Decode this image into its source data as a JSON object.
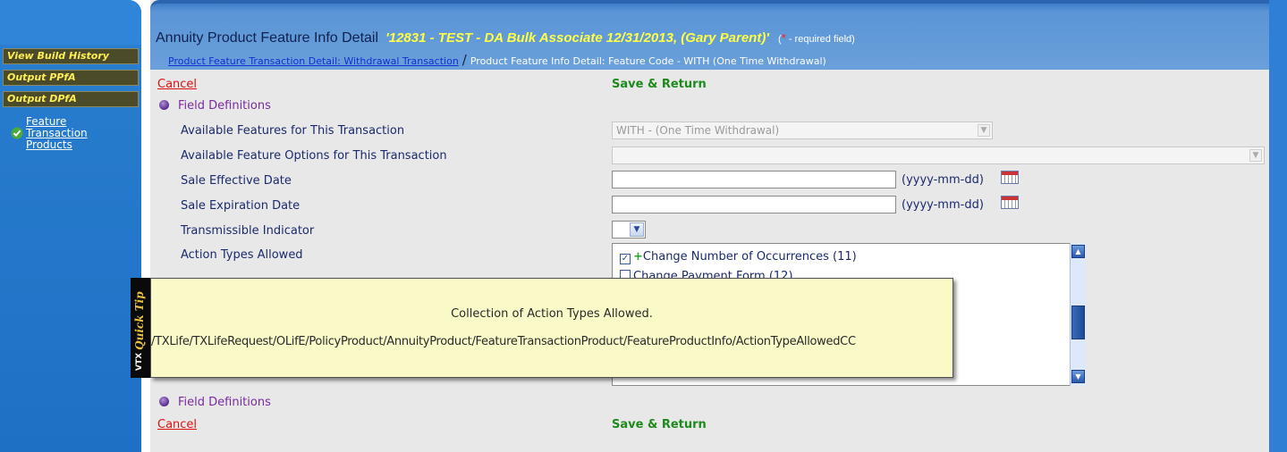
{
  "sidebar": {
    "buttons": [
      "View Build History",
      "Output PPfA",
      "Output DPfA"
    ],
    "feature_links": [
      "Feature",
      "Transaction",
      "Products"
    ],
    "check_icon": "check-circle-icon"
  },
  "header": {
    "title": "Annuity Product Feature Info Detail",
    "record": "'12831 - TEST - DA Bulk Associate 12/31/2013, (Gary Parent)'",
    "req_open": "(",
    "req_star": "*",
    "req_text": " - required field)",
    "breadcrumb_link": "Product Feature Transaction Detail: Withdrawal Transaction",
    "breadcrumb_sep": "/",
    "breadcrumb_current": "Product Feature Info Detail: Feature Code - WITH (One Time Withdrawal)"
  },
  "actions": {
    "cancel": "Cancel",
    "save_return": "Save & Return",
    "field_definitions": "Field Definitions"
  },
  "form": {
    "available_features_label": "Available Features for This Transaction",
    "available_features_value": "WITH - (One Time Withdrawal)",
    "available_options_label": "Available Feature Options for This Transaction",
    "available_options_value": "",
    "sale_effective_label": "Sale Effective Date",
    "sale_effective_value": "",
    "sale_expiration_label": "Sale Expiration Date",
    "sale_expiration_value": "",
    "date_format": "(yyyy-mm-dd)",
    "transmissible_label": "Transmissible Indicator",
    "transmissible_value": "",
    "action_types_label": "Action Types Allowed",
    "action_types_items": [
      {
        "label": "Change Number of Occurrences (11)",
        "checked": true,
        "plus": "+"
      },
      {
        "label": "Change Payment Form (12)",
        "checked": false,
        "plus": ""
      }
    ]
  },
  "tooltip": {
    "brand_prefix": "VTX",
    "brand_suffix": "Quick Tip",
    "message": "Collection of Action Types Allowed.",
    "path": "/TXLife/TXLifeRequest/OLifE/PolicyProduct/AnnuityProduct/FeatureTransactionProduct/FeatureProductInfo/ActionTypeAllowedCC"
  },
  "colors": {
    "sidebar_blue": "#2a7fd0",
    "header_blue": "#5b95d6",
    "record_yellow": "#ffff44",
    "cancel_red": "#dd1111",
    "save_green": "#1c8a1c",
    "tooltip_bg": "#fafac8"
  }
}
